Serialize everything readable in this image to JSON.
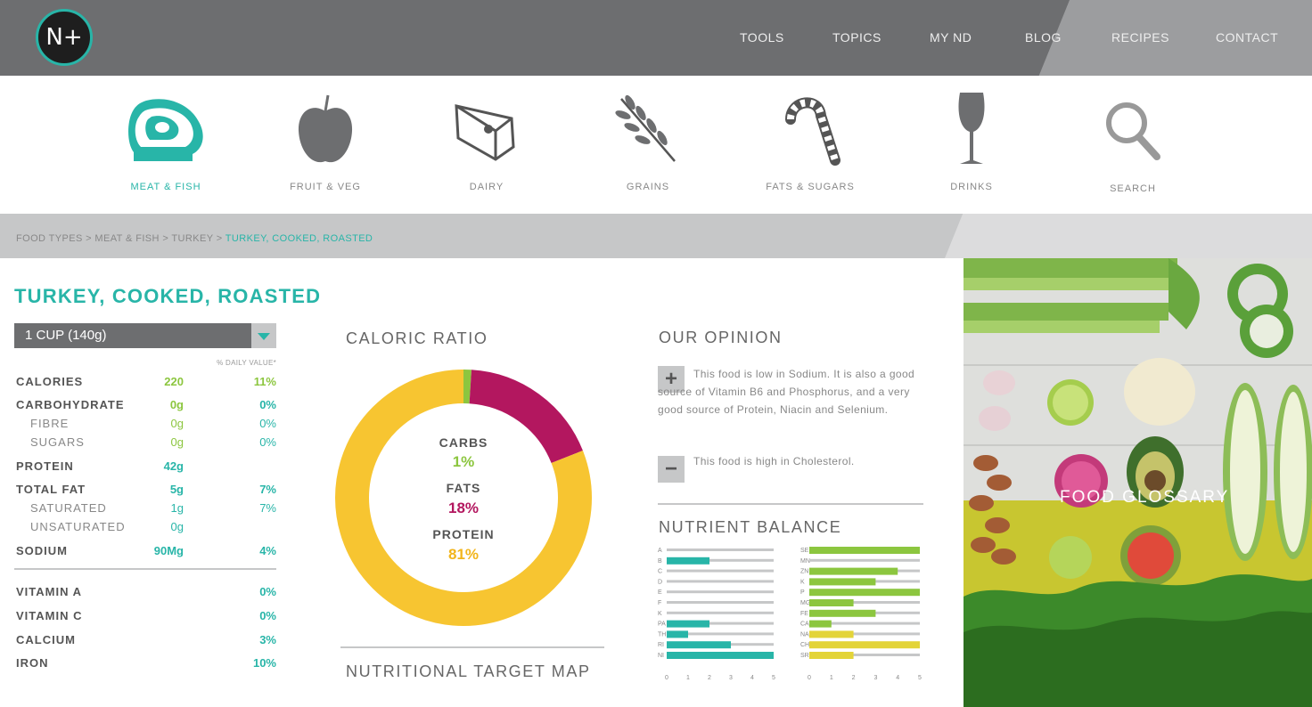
{
  "header": {
    "logo_text": "N+",
    "nav": [
      "TOOLS",
      "TOPICS",
      "MY ND",
      "BLOG",
      "RECIPES",
      "CONTACT"
    ]
  },
  "categories": [
    {
      "label": "MEAT & FISH",
      "icon": "steak-icon",
      "active": true
    },
    {
      "label": "FRUIT & VEG",
      "icon": "apple-icon"
    },
    {
      "label": "DAIRY",
      "icon": "cheese-icon"
    },
    {
      "label": "GRAINS",
      "icon": "wheat-icon"
    },
    {
      "label": "FATS & SUGARS",
      "icon": "candy-cane-icon"
    },
    {
      "label": "DRINKS",
      "icon": "wine-glass-icon"
    },
    {
      "label": "SEARCH",
      "icon": "search-icon"
    }
  ],
  "breadcrumb": {
    "path": "FOOD TYPES > MEAT & FISH > TURKEY  >",
    "current": "TURKEY, COOKED, ROASTED"
  },
  "food": {
    "title": "TURKEY, COOKED, ROASTED",
    "portion": "1 CUP (140g)",
    "dv_header": "% DAILY VALUE*",
    "nutrients": [
      {
        "name": "CALORIES",
        "value": "220",
        "pct": "11%"
      },
      {
        "name": "CARBOHYDRATE",
        "value": "0g",
        "pct": "0%"
      },
      {
        "name": "FIBRE",
        "value": "0g",
        "pct": "0%"
      },
      {
        "name": "SUGARS",
        "value": "0g",
        "pct": "0%"
      },
      {
        "name": "PROTEIN",
        "value": "42g",
        "pct": ""
      },
      {
        "name": "TOTAL FAT",
        "value": "5g",
        "pct": "7%"
      },
      {
        "name": "SATURATED",
        "value": "1g",
        "pct": "7%"
      },
      {
        "name": "UNSATURATED",
        "value": "0g",
        "pct": ""
      },
      {
        "name": "SODIUM",
        "value": "90Mg",
        "pct": "4%"
      }
    ],
    "vitamins": [
      {
        "name": "VITAMIN A",
        "pct": "0%"
      },
      {
        "name": "VITAMIN C",
        "pct": "0%"
      },
      {
        "name": "CALCIUM",
        "pct": "3%"
      },
      {
        "name": "IRON",
        "pct": "10%"
      }
    ]
  },
  "caloric": {
    "title": "CALORIC RATIO",
    "next_title": "NUTRITIONAL TARGET MAP"
  },
  "opinion": {
    "title": "OUR OPINION",
    "positive": "This food is low in Sodium. It is also a good source of Vitamin B6 and Phosphorus, and a very good source of Protein, Niacin and Selenium.",
    "negative": "This food is high in Cholesterol."
  },
  "balance": {
    "title": "NUTRIENT BALANCE"
  },
  "photo": {
    "label": "FOOD GLOSSARY"
  },
  "chart_data": [
    {
      "type": "pie",
      "title": "CALORIC RATIO",
      "categories": [
        "CARBS",
        "FATS",
        "PROTEIN"
      ],
      "values": [
        1,
        18,
        81
      ],
      "colors": [
        "#8cc63f",
        "#b3175f",
        "#f7c531"
      ]
    },
    {
      "type": "bar",
      "title": "NUTRIENT BALANCE",
      "series": [
        {
          "categories": [
            "A",
            "B",
            "C",
            "D",
            "E",
            "F",
            "K",
            "PA",
            "TH",
            "RI",
            "NI"
          ],
          "values": [
            0,
            2,
            0,
            0,
            0,
            0,
            0,
            2,
            1,
            3,
            5
          ],
          "color": "#28b5a8"
        },
        {
          "categories": [
            "SE",
            "MN",
            "ZN",
            "K",
            "P",
            "MG",
            "FE",
            "CA",
            "NA",
            "CH",
            "SR"
          ],
          "values": [
            5,
            0,
            4,
            3,
            5,
            2,
            3,
            1,
            2,
            5,
            2
          ],
          "colors": [
            "#8cc63f",
            "#8cc63f",
            "#8cc63f",
            "#8cc63f",
            "#8cc63f",
            "#8cc63f",
            "#8cc63f",
            "#8cc63f",
            "#e3d439",
            "#e3d439",
            "#e3d439"
          ]
        }
      ],
      "ticks": [
        "0",
        "1",
        "2",
        "3",
        "4",
        "5"
      ],
      "xlim": [
        0,
        5
      ]
    }
  ]
}
